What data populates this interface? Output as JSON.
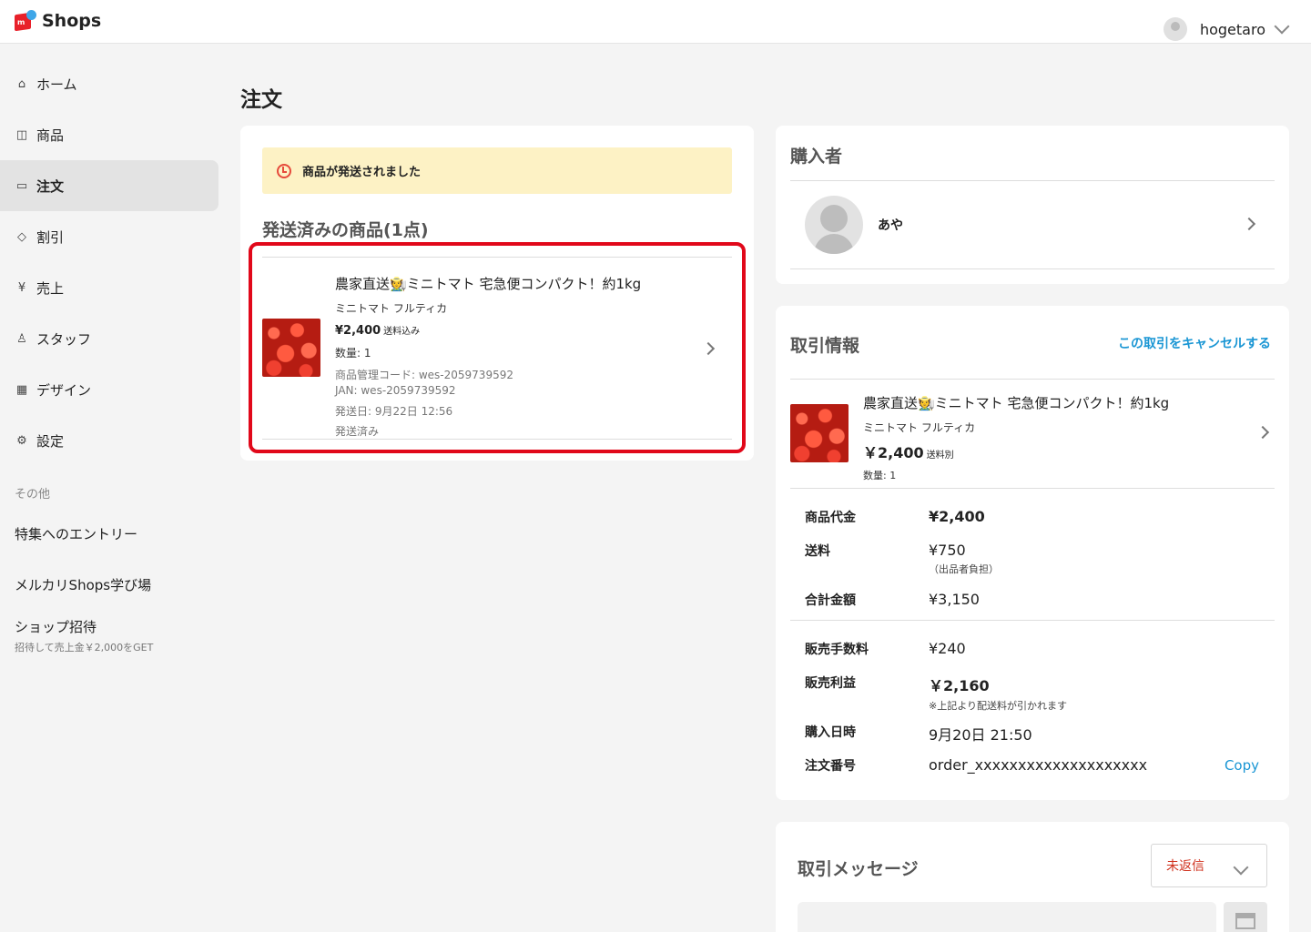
{
  "app": {
    "logo_text": "Shops",
    "logo_letter": "m"
  },
  "user": {
    "name": "hogetaro"
  },
  "sidebar": {
    "items": [
      {
        "label": "ホーム",
        "icon": "home-icon",
        "glyph": "⌂"
      },
      {
        "label": "商品",
        "icon": "camera-icon",
        "glyph": "◫"
      },
      {
        "label": "注文",
        "icon": "box-icon",
        "glyph": "▭"
      },
      {
        "label": "割引",
        "icon": "tag-icon",
        "glyph": "◇"
      },
      {
        "label": "売上",
        "icon": "yen-icon",
        "glyph": "¥"
      },
      {
        "label": "スタッフ",
        "icon": "person-icon",
        "glyph": "♙"
      },
      {
        "label": "デザイン",
        "icon": "store-icon",
        "glyph": "▦"
      },
      {
        "label": "設定",
        "icon": "gear-icon",
        "glyph": "⚙"
      }
    ],
    "other_heading": "その他",
    "links": [
      {
        "label": "特集へのエントリー"
      },
      {
        "label": "メルカリShops学び場"
      },
      {
        "label": "ショップ招待",
        "sub": "招待して売上金￥2,000をGET"
      }
    ]
  },
  "page": {
    "title": "注文"
  },
  "shipped": {
    "notice": "商品が発送されました",
    "heading": "発送済みの商品(1点)",
    "item": {
      "title": "農家直送🧑‍🌾ミニトマト 宅急便コンパクト！約1kg",
      "variant": "ミニトマト フルティカ",
      "price": "¥2,400",
      "price_note": "送料込み",
      "qty": "数量: 1",
      "code": "商品管理コード: wes-2059739592",
      "jan": "JAN: wes-2059739592",
      "ship_date": "発送日: 9月22日 12:56",
      "status": "発送済み"
    }
  },
  "buyer": {
    "heading": "購入者",
    "name": "あや"
  },
  "trade": {
    "heading": "取引情報",
    "cancel": "この取引をキャンセルする",
    "item": {
      "title": "農家直送🧑‍🌾ミニトマト 宅急便コンパクト！約1kg",
      "variant": "ミニトマト フルティカ",
      "price": "￥2,400",
      "price_note": "送料別",
      "qty": "数量: 1"
    },
    "rows": {
      "subtotal_k": "商品代金",
      "subtotal_v": "¥2,400",
      "shipping_k": "送料",
      "shipping_v": "¥750",
      "shipping_note": "（出品者負担）",
      "total_k": "合計金額",
      "total_v": "¥3,150",
      "fee_k": "販売手数料",
      "fee_v": "¥240",
      "profit_k": "販売利益",
      "profit_v": "￥2,160",
      "profit_note": "※上記より配送料が引かれます",
      "date_k": "購入日時",
      "date_v": "9月20日 21:50",
      "order_k": "注文番号",
      "order_v": "order_xxxxxxxxxxxxxxxxxxxx",
      "copy": "Copy"
    }
  },
  "message": {
    "heading": "取引メッセージ",
    "status": "未返信"
  }
}
